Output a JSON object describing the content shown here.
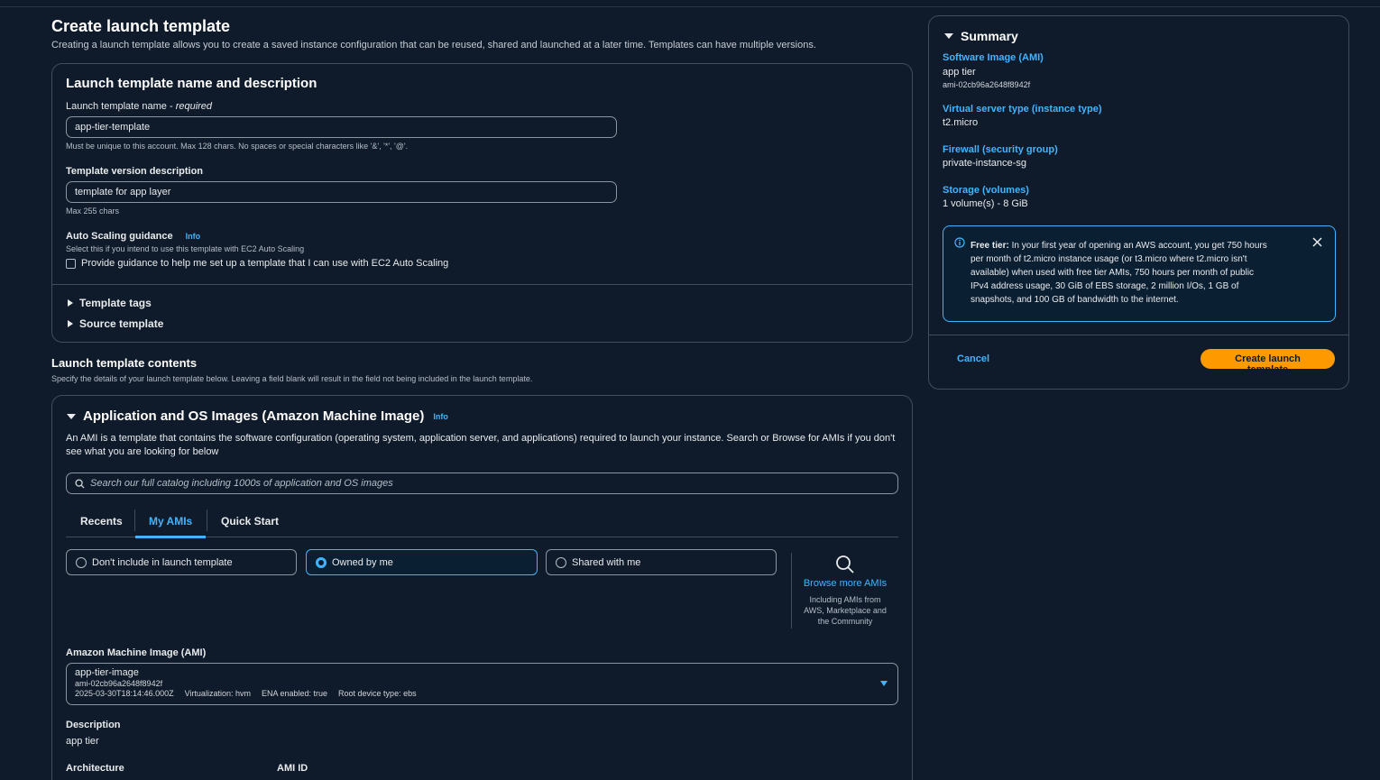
{
  "header": {
    "title": "Create launch template",
    "subtitle": "Creating a launch template allows you to create a saved instance configuration that can be reused, shared and launched at a later time. Templates can have multiple versions."
  },
  "name_panel": {
    "title": "Launch template name and description",
    "name_label": "Launch template name - ",
    "name_label_req": "required",
    "name_value": "app-tier-template",
    "name_hint": "Must be unique to this account. Max 128 chars. No spaces or special characters like '&', '*', '@'.",
    "desc_label": "Template version description",
    "desc_value": "template for app layer",
    "desc_hint": "Max 255 chars",
    "asg_label": "Auto Scaling guidance",
    "asg_info": "Info",
    "asg_hint": "Select this if you intend to use this template with EC2 Auto Scaling",
    "asg_checkbox": "Provide guidance to help me set up a template that I can use with EC2 Auto Scaling",
    "tags": "Template tags",
    "source": "Source template"
  },
  "contents": {
    "title": "Launch template contents",
    "subtitle": "Specify the details of your launch template below. Leaving a field blank will result in the field not being included in the launch template."
  },
  "ami_panel": {
    "title": "Application and OS Images (Amazon Machine Image)",
    "info": "Info",
    "desc": "An AMI is a template that contains the software configuration (operating system, application server, and applications) required to launch your instance. Search or Browse for AMIs if you don't see what you are looking for below",
    "search_placeholder": "Search our full catalog including 1000s of application and OS images",
    "tabs": [
      "Recents",
      "My AMIs",
      "Quick Start"
    ],
    "radios": [
      "Don't include in launch template",
      "Owned by me",
      "Shared with me"
    ],
    "browse_label": "Browse more AMIs",
    "browse_desc_1": "Including AMIs from",
    "browse_desc_2": "AWS, Marketplace and",
    "browse_desc_3": "the Community",
    "ami_label": "Amazon Machine Image (AMI)",
    "ami_name": "app-tier-image",
    "ami_id": "ami-02cb96a2648f8942f",
    "ami_date": "2025-03-30T18:14:46.000Z",
    "ami_virt": "Virtualization: hvm",
    "ami_ena": "ENA enabled: true",
    "ami_root": "Root device type: ebs",
    "description_label": "Description",
    "description_value": "app tier",
    "arch_label": "Architecture",
    "amiid_label": "AMI ID"
  },
  "summary": {
    "title": "Summary",
    "ami_key": "Software Image (AMI)",
    "ami_val": "app tier",
    "ami_id": "ami-02cb96a2648f8942f",
    "type_key": "Virtual server type (instance type)",
    "type_val": "t2.micro",
    "fw_key": "Firewall (security group)",
    "fw_val": "private-instance-sg",
    "storage_key": "Storage (volumes)",
    "storage_val": "1 volume(s) - 8 GiB",
    "free_bold": "Free tier:",
    "free_l1": " In your first year of opening an AWS account, you get 750 hours",
    "free_l2": "per month of t2.micro instance usage (or t3.micro where t2.micro isn't",
    "free_l3": "available) when used with free tier AMIs, 750 hours per month of public",
    "free_l4": "IPv4 address usage, 30 GiB of EBS storage, 2 million I/Os, 1 GB of",
    "free_l5": "snapshots, and 100 GB of bandwidth to the internet.",
    "cancel": "Cancel",
    "create": "Create launch template"
  },
  "colors": {
    "accent": "#42b4ff",
    "primary": "#ff9900",
    "bg": "#0f1b2a",
    "border": "#414d5c"
  }
}
